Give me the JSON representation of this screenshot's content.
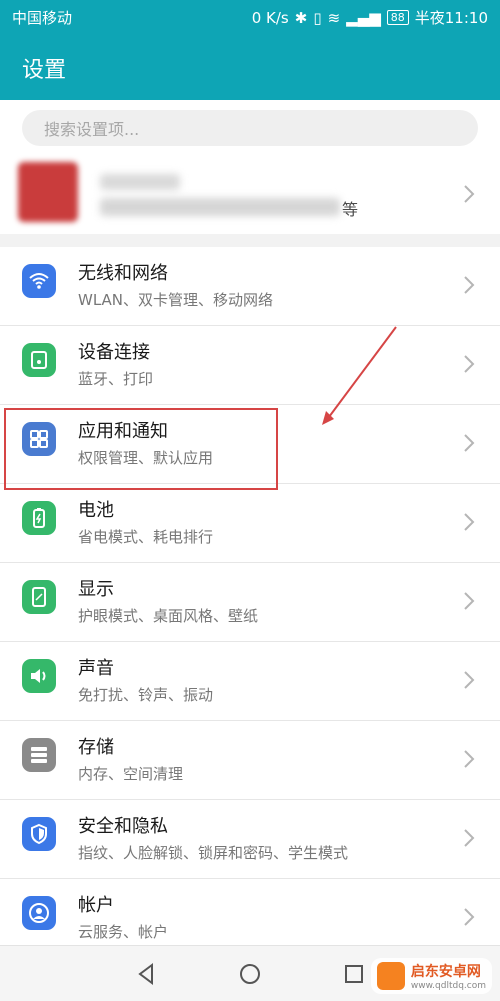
{
  "status_bar": {
    "carrier": "中国移动",
    "speed": "0 K/s",
    "battery": "88",
    "time": "半夜11:10"
  },
  "header": {
    "title": "设置"
  },
  "search": {
    "placeholder": "搜索设置项..."
  },
  "profile": {
    "subtitle_end": "等"
  },
  "settings": [
    {
      "title": "无线和网络",
      "subtitle": "WLAN、双卡管理、移动网络",
      "icon": "wifi-icon",
      "color": "#3b78e7"
    },
    {
      "title": "设备连接",
      "subtitle": "蓝牙、打印",
      "icon": "device-connect-icon",
      "color": "#35b86a"
    },
    {
      "title": "应用和通知",
      "subtitle": "权限管理、默认应用",
      "icon": "apps-icon",
      "color": "#4a7bd0"
    },
    {
      "title": "电池",
      "subtitle": "省电模式、耗电排行",
      "icon": "battery-icon",
      "color": "#35b86a"
    },
    {
      "title": "显示",
      "subtitle": "护眼模式、桌面风格、壁纸",
      "icon": "display-icon",
      "color": "#35b86a"
    },
    {
      "title": "声音",
      "subtitle": "免打扰、铃声、振动",
      "icon": "sound-icon",
      "color": "#35b86a"
    },
    {
      "title": "存储",
      "subtitle": "内存、空间清理",
      "icon": "storage-icon",
      "color": "#8a8a8a"
    },
    {
      "title": "安全和隐私",
      "subtitle": "指纹、人脸解锁、锁屏和密码、学生模式",
      "icon": "shield-icon",
      "color": "#3b78e7"
    },
    {
      "title": "帐户",
      "subtitle": "云服务、帐户",
      "icon": "account-icon",
      "color": "#3b78e7"
    }
  ],
  "watermark": {
    "name": "启东安卓网",
    "url": "www.qdltdq.com"
  }
}
